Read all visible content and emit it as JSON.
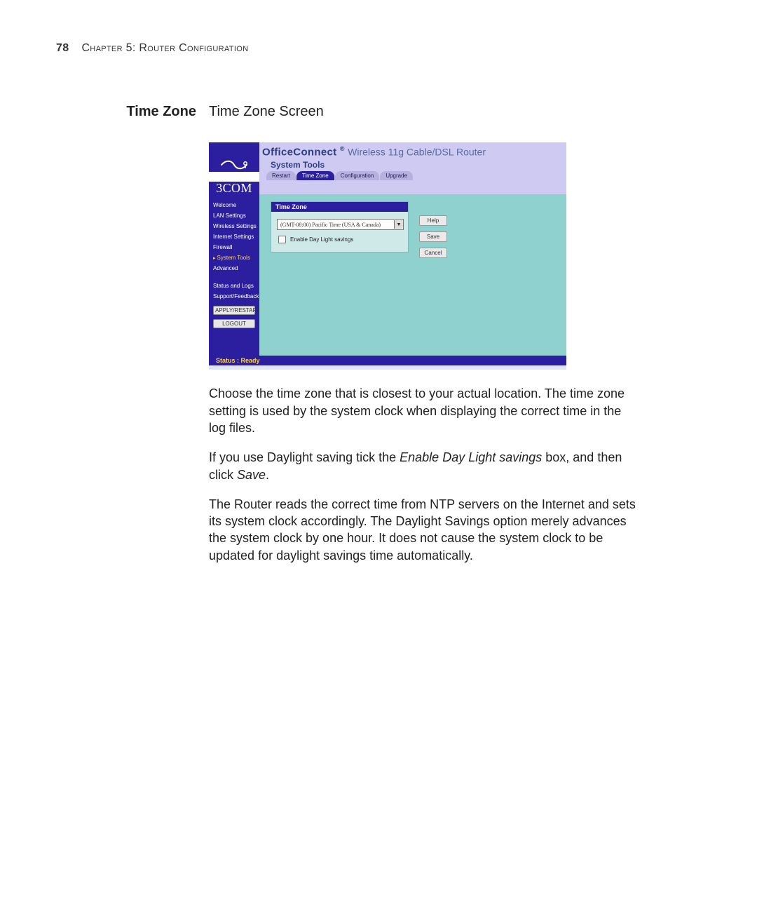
{
  "page_header": {
    "number": "78",
    "chapter": "Chapter 5: Router Configuration"
  },
  "section": {
    "side_label": "Time Zone",
    "title": "Time Zone Screen"
  },
  "router_ui": {
    "brand": "3COM",
    "product_brand": "OfficeConnect",
    "product_sub": "Wireless 11g Cable/DSL Router",
    "category": "System Tools",
    "tabs": {
      "restart": "Restart",
      "timezone": "Time Zone",
      "config": "Configuration",
      "upgrade": "Upgrade"
    },
    "nav": {
      "welcome": "Welcome",
      "lan": "LAN Settings",
      "wireless": "Wireless Settings",
      "internet": "Internet Settings",
      "firewall": "Firewall",
      "system_tools": "System Tools",
      "advanced": "Advanced",
      "status_logs": "Status and Logs",
      "support": "Support/Feedback",
      "apply_restart": "APPLY/RESTART",
      "logout": "LOGOUT"
    },
    "panel": {
      "title": "Time Zone",
      "tz_value": "(GMT-08:00) Pacific Time (USA & Canada)",
      "daylight_label": "Enable Day Light savings"
    },
    "buttons": {
      "help": "Help",
      "save": "Save",
      "cancel": "Cancel"
    },
    "status": "Status : Ready"
  },
  "body": {
    "p1": "Choose the time zone that is closest to your actual location. The time zone setting is used by the system clock when displaying the correct time in the log files.",
    "p2a": "If you use Daylight saving tick the ",
    "p2_em1": "Enable Day Light savings",
    "p2b": " box, and then click ",
    "p2_em2": "Save",
    "p2c": ".",
    "p3": "The Router reads the correct time from NTP servers on the Internet and sets its system clock accordingly. The Daylight Savings option merely advances the system clock by one hour. It does not cause the system clock to be updated for daylight savings time automatically."
  }
}
